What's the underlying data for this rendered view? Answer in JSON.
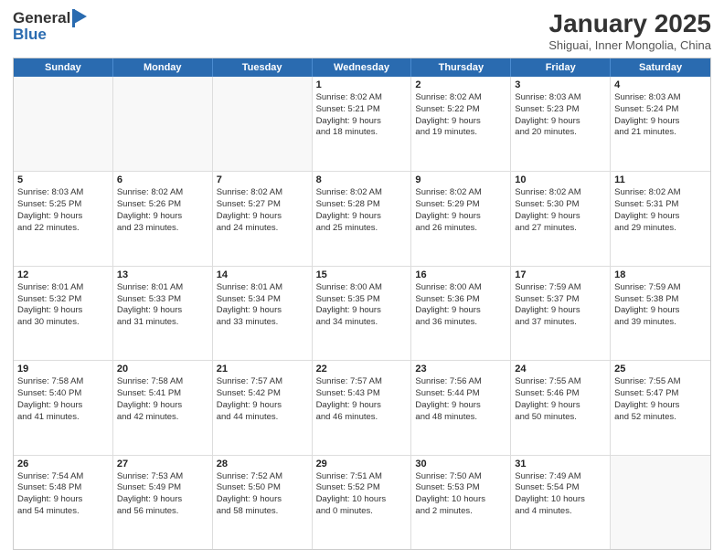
{
  "header": {
    "logo_line1": "General",
    "logo_line2": "Blue",
    "month_year": "January 2025",
    "location": "Shiguai, Inner Mongolia, China"
  },
  "weekdays": [
    "Sunday",
    "Monday",
    "Tuesday",
    "Wednesday",
    "Thursday",
    "Friday",
    "Saturday"
  ],
  "weeks": [
    [
      {
        "day": "",
        "sunrise": "",
        "sunset": "",
        "daylight": "",
        "empty": true
      },
      {
        "day": "",
        "sunrise": "",
        "sunset": "",
        "daylight": "",
        "empty": true
      },
      {
        "day": "",
        "sunrise": "",
        "sunset": "",
        "daylight": "",
        "empty": true
      },
      {
        "day": "1",
        "sunrise": "Sunrise: 8:02 AM",
        "sunset": "Sunset: 5:21 PM",
        "daylight": "Daylight: 9 hours and 18 minutes.",
        "empty": false
      },
      {
        "day": "2",
        "sunrise": "Sunrise: 8:02 AM",
        "sunset": "Sunset: 5:22 PM",
        "daylight": "Daylight: 9 hours and 19 minutes.",
        "empty": false
      },
      {
        "day": "3",
        "sunrise": "Sunrise: 8:03 AM",
        "sunset": "Sunset: 5:23 PM",
        "daylight": "Daylight: 9 hours and 20 minutes.",
        "empty": false
      },
      {
        "day": "4",
        "sunrise": "Sunrise: 8:03 AM",
        "sunset": "Sunset: 5:24 PM",
        "daylight": "Daylight: 9 hours and 21 minutes.",
        "empty": false
      }
    ],
    [
      {
        "day": "5",
        "sunrise": "Sunrise: 8:03 AM",
        "sunset": "Sunset: 5:25 PM",
        "daylight": "Daylight: 9 hours and 22 minutes.",
        "empty": false
      },
      {
        "day": "6",
        "sunrise": "Sunrise: 8:02 AM",
        "sunset": "Sunset: 5:26 PM",
        "daylight": "Daylight: 9 hours and 23 minutes.",
        "empty": false
      },
      {
        "day": "7",
        "sunrise": "Sunrise: 8:02 AM",
        "sunset": "Sunset: 5:27 PM",
        "daylight": "Daylight: 9 hours and 24 minutes.",
        "empty": false
      },
      {
        "day": "8",
        "sunrise": "Sunrise: 8:02 AM",
        "sunset": "Sunset: 5:28 PM",
        "daylight": "Daylight: 9 hours and 25 minutes.",
        "empty": false
      },
      {
        "day": "9",
        "sunrise": "Sunrise: 8:02 AM",
        "sunset": "Sunset: 5:29 PM",
        "daylight": "Daylight: 9 hours and 26 minutes.",
        "empty": false
      },
      {
        "day": "10",
        "sunrise": "Sunrise: 8:02 AM",
        "sunset": "Sunset: 5:30 PM",
        "daylight": "Daylight: 9 hours and 27 minutes.",
        "empty": false
      },
      {
        "day": "11",
        "sunrise": "Sunrise: 8:02 AM",
        "sunset": "Sunset: 5:31 PM",
        "daylight": "Daylight: 9 hours and 29 minutes.",
        "empty": false
      }
    ],
    [
      {
        "day": "12",
        "sunrise": "Sunrise: 8:01 AM",
        "sunset": "Sunset: 5:32 PM",
        "daylight": "Daylight: 9 hours and 30 minutes.",
        "empty": false
      },
      {
        "day": "13",
        "sunrise": "Sunrise: 8:01 AM",
        "sunset": "Sunset: 5:33 PM",
        "daylight": "Daylight: 9 hours and 31 minutes.",
        "empty": false
      },
      {
        "day": "14",
        "sunrise": "Sunrise: 8:01 AM",
        "sunset": "Sunset: 5:34 PM",
        "daylight": "Daylight: 9 hours and 33 minutes.",
        "empty": false
      },
      {
        "day": "15",
        "sunrise": "Sunrise: 8:00 AM",
        "sunset": "Sunset: 5:35 PM",
        "daylight": "Daylight: 9 hours and 34 minutes.",
        "empty": false
      },
      {
        "day": "16",
        "sunrise": "Sunrise: 8:00 AM",
        "sunset": "Sunset: 5:36 PM",
        "daylight": "Daylight: 9 hours and 36 minutes.",
        "empty": false
      },
      {
        "day": "17",
        "sunrise": "Sunrise: 7:59 AM",
        "sunset": "Sunset: 5:37 PM",
        "daylight": "Daylight: 9 hours and 37 minutes.",
        "empty": false
      },
      {
        "day": "18",
        "sunrise": "Sunrise: 7:59 AM",
        "sunset": "Sunset: 5:38 PM",
        "daylight": "Daylight: 9 hours and 39 minutes.",
        "empty": false
      }
    ],
    [
      {
        "day": "19",
        "sunrise": "Sunrise: 7:58 AM",
        "sunset": "Sunset: 5:40 PM",
        "daylight": "Daylight: 9 hours and 41 minutes.",
        "empty": false
      },
      {
        "day": "20",
        "sunrise": "Sunrise: 7:58 AM",
        "sunset": "Sunset: 5:41 PM",
        "daylight": "Daylight: 9 hours and 42 minutes.",
        "empty": false
      },
      {
        "day": "21",
        "sunrise": "Sunrise: 7:57 AM",
        "sunset": "Sunset: 5:42 PM",
        "daylight": "Daylight: 9 hours and 44 minutes.",
        "empty": false
      },
      {
        "day": "22",
        "sunrise": "Sunrise: 7:57 AM",
        "sunset": "Sunset: 5:43 PM",
        "daylight": "Daylight: 9 hours and 46 minutes.",
        "empty": false
      },
      {
        "day": "23",
        "sunrise": "Sunrise: 7:56 AM",
        "sunset": "Sunset: 5:44 PM",
        "daylight": "Daylight: 9 hours and 48 minutes.",
        "empty": false
      },
      {
        "day": "24",
        "sunrise": "Sunrise: 7:55 AM",
        "sunset": "Sunset: 5:46 PM",
        "daylight": "Daylight: 9 hours and 50 minutes.",
        "empty": false
      },
      {
        "day": "25",
        "sunrise": "Sunrise: 7:55 AM",
        "sunset": "Sunset: 5:47 PM",
        "daylight": "Daylight: 9 hours and 52 minutes.",
        "empty": false
      }
    ],
    [
      {
        "day": "26",
        "sunrise": "Sunrise: 7:54 AM",
        "sunset": "Sunset: 5:48 PM",
        "daylight": "Daylight: 9 hours and 54 minutes.",
        "empty": false
      },
      {
        "day": "27",
        "sunrise": "Sunrise: 7:53 AM",
        "sunset": "Sunset: 5:49 PM",
        "daylight": "Daylight: 9 hours and 56 minutes.",
        "empty": false
      },
      {
        "day": "28",
        "sunrise": "Sunrise: 7:52 AM",
        "sunset": "Sunset: 5:50 PM",
        "daylight": "Daylight: 9 hours and 58 minutes.",
        "empty": false
      },
      {
        "day": "29",
        "sunrise": "Sunrise: 7:51 AM",
        "sunset": "Sunset: 5:52 PM",
        "daylight": "Daylight: 10 hours and 0 minutes.",
        "empty": false
      },
      {
        "day": "30",
        "sunrise": "Sunrise: 7:50 AM",
        "sunset": "Sunset: 5:53 PM",
        "daylight": "Daylight: 10 hours and 2 minutes.",
        "empty": false
      },
      {
        "day": "31",
        "sunrise": "Sunrise: 7:49 AM",
        "sunset": "Sunset: 5:54 PM",
        "daylight": "Daylight: 10 hours and 4 minutes.",
        "empty": false
      },
      {
        "day": "",
        "sunrise": "",
        "sunset": "",
        "daylight": "",
        "empty": true
      }
    ]
  ]
}
